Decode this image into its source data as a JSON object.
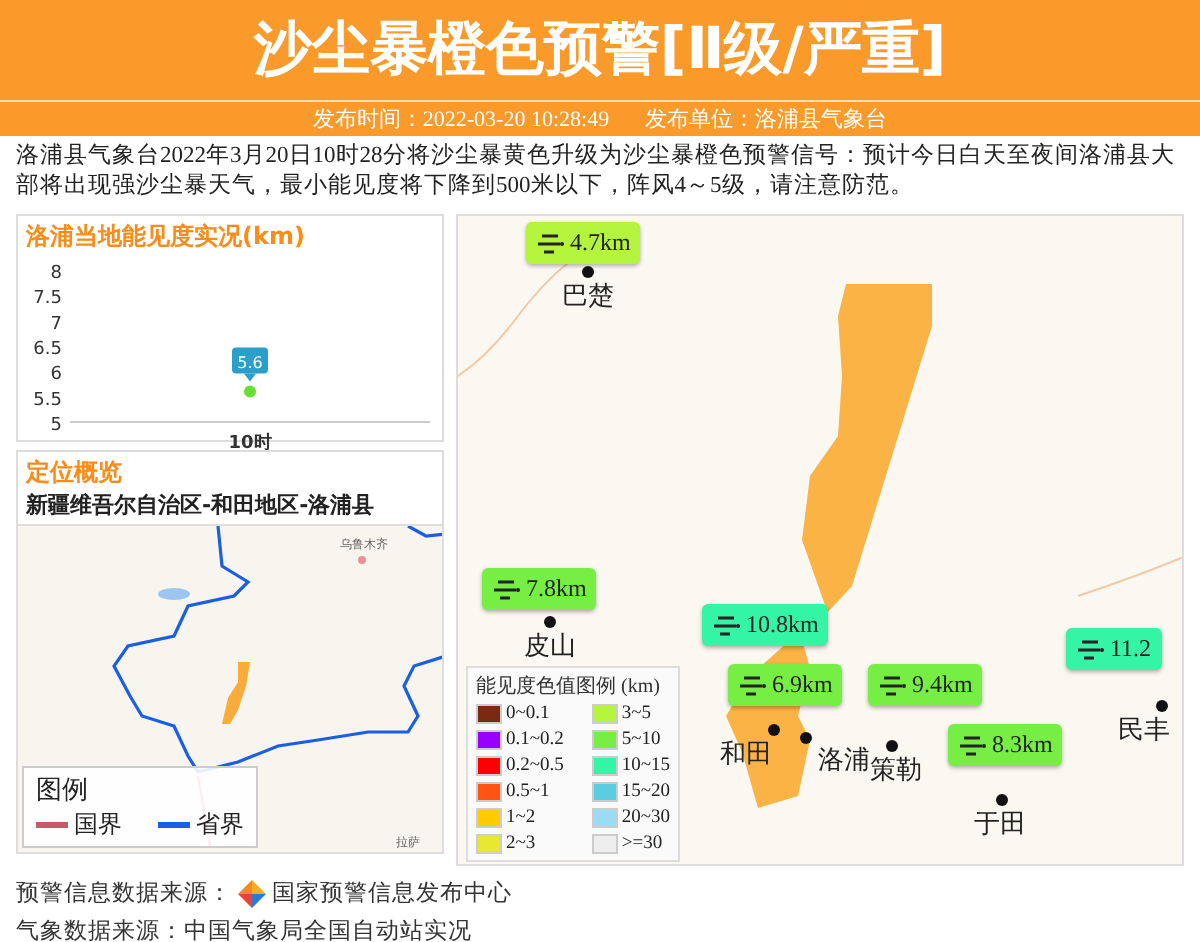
{
  "header": {
    "title": "沙尘暴橙色预警[Ⅱ级/严重]",
    "publish_time": "发布时间：2022-03-20 10:28:49",
    "publisher": "发布单位：洛浦县气象台"
  },
  "description": "洛浦县气象台2022年3月20日10时28分将沙尘暴黄色升级为沙尘暴橙色预警信号：预计今日白天至夜间洛浦县大部将出现强沙尘暴天气，最小能见度将下降到500米以下，阵风4～5级，请注意防范。",
  "visibility_panel": {
    "title": "洛浦当地能见度实况(km)",
    "chart_data": {
      "type": "line",
      "categories": [
        "10时"
      ],
      "series": [
        {
          "color": "#66e033",
          "marker": true,
          "values": [
            5.6
          ]
        }
      ],
      "ylim": [
        5,
        8
      ],
      "yticks": [
        5,
        5.5,
        6,
        6.5,
        7,
        7.5,
        8
      ],
      "data_labels": true
    }
  },
  "location_panel": {
    "title": "定位概览",
    "region": "新疆维吾尔自治区-和田地区-洛浦县",
    "cities": [
      "乌鲁木齐",
      "拉萨"
    ],
    "legend": {
      "title": "图例",
      "items": [
        {
          "label": "国界",
          "color": "#c8596b"
        },
        {
          "label": "省界",
          "color": "#1a5ee6"
        }
      ]
    }
  },
  "station_map": {
    "stations": [
      {
        "name": "巴楚",
        "reading": "4.7km",
        "color": "#b4f43c"
      },
      {
        "name": "皮山",
        "reading": "7.8km",
        "color": "#77ee44"
      },
      {
        "reading": "10.8km",
        "color": "#33f5a5"
      },
      {
        "name": "和田",
        "reading": "6.9km",
        "color": "#77ee44"
      },
      {
        "name": "洛浦"
      },
      {
        "name": "策勒",
        "reading": "9.4km",
        "color": "#77ee44"
      },
      {
        "name": "于田",
        "reading": "8.3km",
        "color": "#77ee44"
      },
      {
        "name": "民丰",
        "reading": "11.2",
        "color": "#33f5a5"
      }
    ],
    "legend": {
      "title": "能见度色值图例 (km)",
      "items": [
        {
          "label": "0~0.1",
          "color": "#7a2a10"
        },
        {
          "label": "0.1~0.2",
          "color": "#9900ff"
        },
        {
          "label": "0.2~0.5",
          "color": "#ff0000"
        },
        {
          "label": "0.5~1",
          "color": "#ff5511"
        },
        {
          "label": "1~2",
          "color": "#ffcc00"
        },
        {
          "label": "2~3",
          "color": "#e8e830"
        },
        {
          "label": "3~5",
          "color": "#b4f43c"
        },
        {
          "label": "5~10",
          "color": "#77ee44"
        },
        {
          "label": "10~15",
          "color": "#33f5a5"
        },
        {
          "label": "15~20",
          "color": "#5bcde0"
        },
        {
          "label": "20~30",
          "color": "#99ddf5"
        },
        {
          "label": ">=30",
          "color": "#eeeeee"
        }
      ]
    }
  },
  "footer": {
    "warning_source": "预警信息数据来源：",
    "warning_source_name": "国家预警信息发布中心",
    "weather_source": "气象数据来源：中国气象局全国自动站实况"
  }
}
